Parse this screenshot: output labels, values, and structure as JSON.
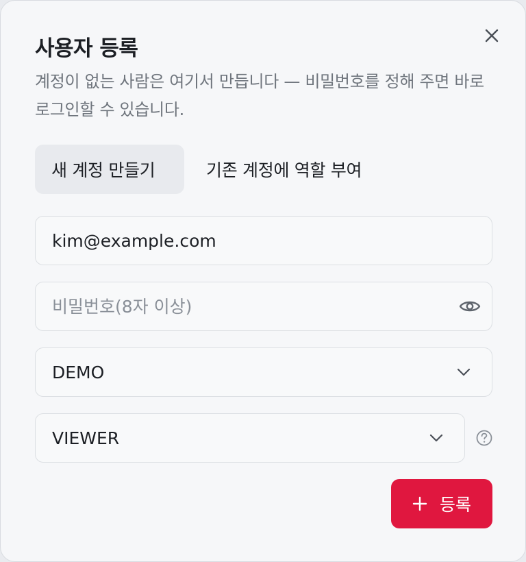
{
  "dialog": {
    "title": "사용자 등록",
    "subtitle": "계정이 없는 사람은 여기서 만듭니다 — 비밀번호를 정해 주면 바로 로그인할 수 있습니다."
  },
  "tabs": [
    {
      "label": "새 계정 만들기",
      "active": true
    },
    {
      "label": "기존 계정에 역할 부여",
      "active": false
    }
  ],
  "form": {
    "email_value": "kim@example.com",
    "password_placeholder": "비밀번호(8자 이상)",
    "org_select_value": "DEMO",
    "role_select_value": "VIEWER"
  },
  "actions": {
    "submit_label": "등록"
  },
  "colors": {
    "accent": "#e0173f",
    "background": "#f6f7f9",
    "muted_text": "#6f757d"
  },
  "icons": {
    "close": "close-icon",
    "password_toggle": "eye-icon",
    "select_arrow": "chevron-down-icon",
    "help": "help-circle-icon",
    "submit": "plus-icon"
  }
}
